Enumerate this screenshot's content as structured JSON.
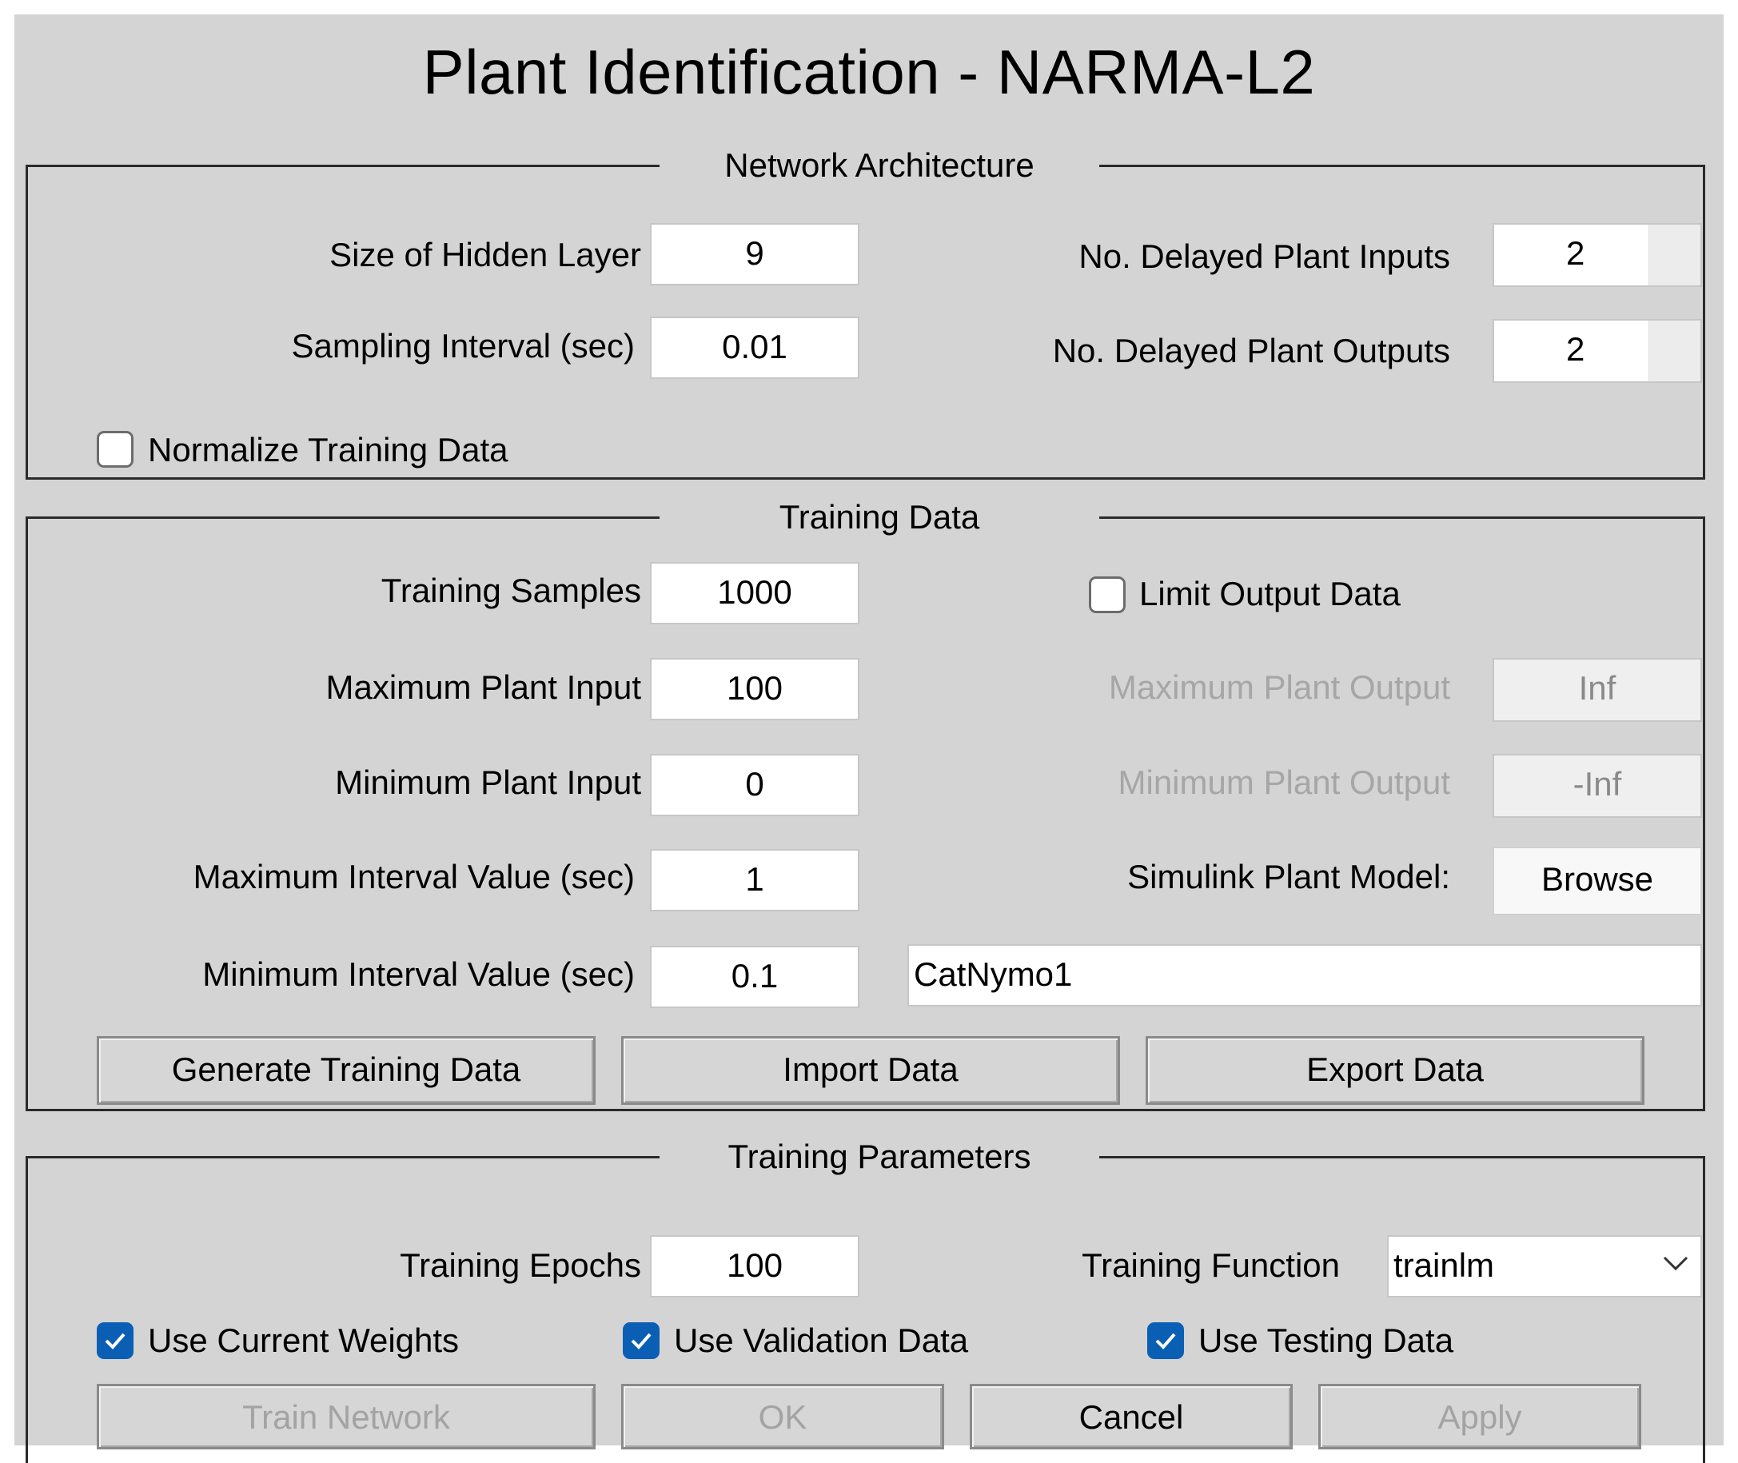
{
  "window": {
    "title": "Plant Identification - NARMA-L2"
  },
  "network_architecture": {
    "title": "Network Architecture",
    "hidden_layer_size": {
      "label": "Size of Hidden Layer",
      "value": "9"
    },
    "sampling_interval": {
      "label": "Sampling Interval (sec)",
      "value": "0.01"
    },
    "delayed_inputs": {
      "label": "No. Delayed Plant Inputs",
      "value": "2"
    },
    "delayed_outputs": {
      "label": "No. Delayed Plant Outputs",
      "value": "2"
    },
    "normalize": {
      "label": "Normalize Training Data",
      "checked": false
    }
  },
  "training_data": {
    "title": "Training Data",
    "samples": {
      "label": "Training Samples",
      "value": "1000"
    },
    "limit_output": {
      "label": "Limit Output Data",
      "checked": false
    },
    "max_input": {
      "label": "Maximum Plant Input",
      "value": "100"
    },
    "max_output": {
      "label": "Maximum Plant Output",
      "value": "Inf"
    },
    "min_input": {
      "label": "Minimum Plant Input",
      "value": "0"
    },
    "min_output": {
      "label": "Minimum Plant Output",
      "value": "-Inf"
    },
    "max_interval": {
      "label": "Maximum Interval Value (sec)",
      "value": "1"
    },
    "plant_model": {
      "label": "Simulink Plant Model:",
      "browse_label": "Browse",
      "value": "CatNymo1"
    },
    "min_interval": {
      "label": "Minimum Interval Value (sec)",
      "value": "0.1"
    },
    "buttons": {
      "generate": "Generate Training Data",
      "import": "Import Data",
      "export": "Export Data"
    }
  },
  "training_parameters": {
    "title": "Training Parameters",
    "epochs": {
      "label": "Training Epochs",
      "value": "100"
    },
    "function": {
      "label": "Training Function",
      "value": "trainlm"
    },
    "use_current_weights": {
      "label": "Use Current Weights",
      "checked": true
    },
    "use_validation": {
      "label": "Use Validation Data",
      "checked": true
    },
    "use_testing": {
      "label": "Use Testing Data",
      "checked": true
    }
  },
  "footer_buttons": {
    "train": "Train Network",
    "ok": "OK",
    "cancel": "Cancel",
    "apply": "Apply"
  },
  "colors": {
    "window_bg": "#d4d4d4",
    "checkbox_accent": "#0a5fb4",
    "disabled_text": "#a6a6a6"
  },
  "icons": {
    "check": "check-icon",
    "dropdown": "chevron-down-icon"
  }
}
